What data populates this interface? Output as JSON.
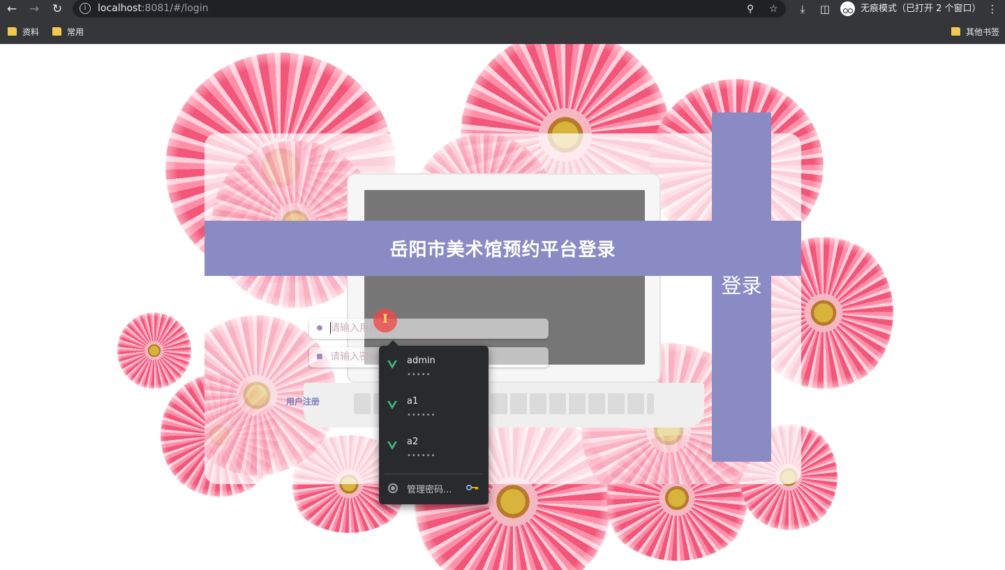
{
  "browser": {
    "url_host": "localhost",
    "url_rest": ":8081/#/login",
    "incognito_label": "无痕模式（已打开 2 个窗口）",
    "bookmarks": [
      "资料",
      "常用"
    ],
    "other_bookmarks": "其他书签"
  },
  "page": {
    "title": "岳阳市美术馆预约平台登录",
    "login_button": "登录",
    "username_placeholder": "请输入用户名",
    "password_placeholder": "请输入密码",
    "register_link": "用户注册"
  },
  "password_dropdown": {
    "items": [
      {
        "username": "admin",
        "password_mask": "•••••"
      },
      {
        "username": "a1",
        "password_mask": "••••••"
      },
      {
        "username": "a2",
        "password_mask": "••••••"
      }
    ],
    "manage_label": "管理密码..."
  },
  "colors": {
    "accent": "#8a8bc4",
    "chrome_bg": "#35363a",
    "dropdown_bg": "#292a2d",
    "vue_green": "#42b883"
  }
}
